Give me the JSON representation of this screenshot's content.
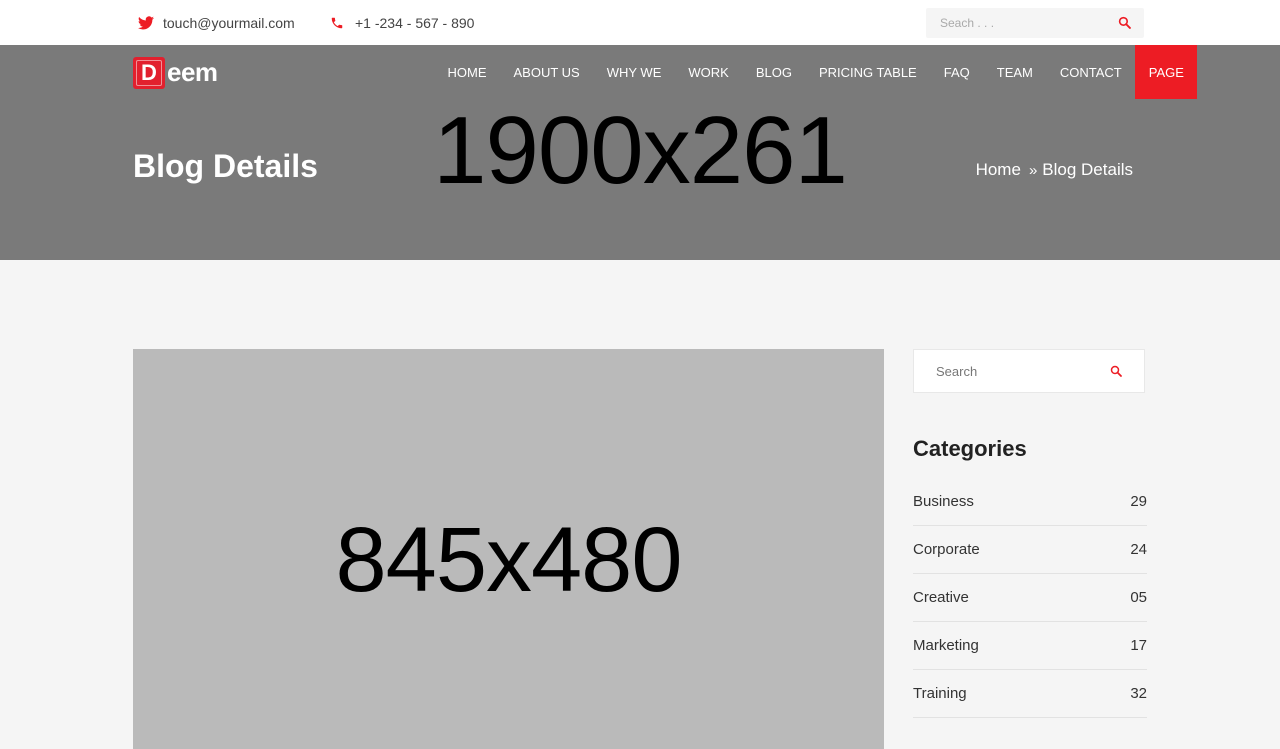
{
  "topbar": {
    "email": "touch@yourmail.com",
    "phone": "+1 -234 - 567 - 890",
    "search_placeholder": "Seach . . ."
  },
  "brand": {
    "logo_letter": "D",
    "logo_text": "eem",
    "accent_color": "#ed1c24"
  },
  "nav": {
    "items": [
      "HOME",
      "ABOUT US",
      "WHY WE",
      "WORK",
      "BLOG",
      "PRICING TABLE",
      "FAQ",
      "TEAM",
      "CONTACT",
      "PAGE"
    ],
    "active_item": "PAGE"
  },
  "hero": {
    "title": "Blog Details",
    "placeholder_text": "1900x261",
    "breadcrumb": [
      "Home",
      "Blog Details"
    ]
  },
  "post": {
    "image_placeholder_text": "845x480"
  },
  "sidebar": {
    "search_placeholder": "Search",
    "categories_title": "Categories",
    "categories": [
      {
        "name": "Business",
        "count": "29"
      },
      {
        "name": "Corporate",
        "count": "24"
      },
      {
        "name": "Creative",
        "count": "05"
      },
      {
        "name": "Marketing",
        "count": "17"
      },
      {
        "name": "Training",
        "count": "32"
      }
    ]
  }
}
